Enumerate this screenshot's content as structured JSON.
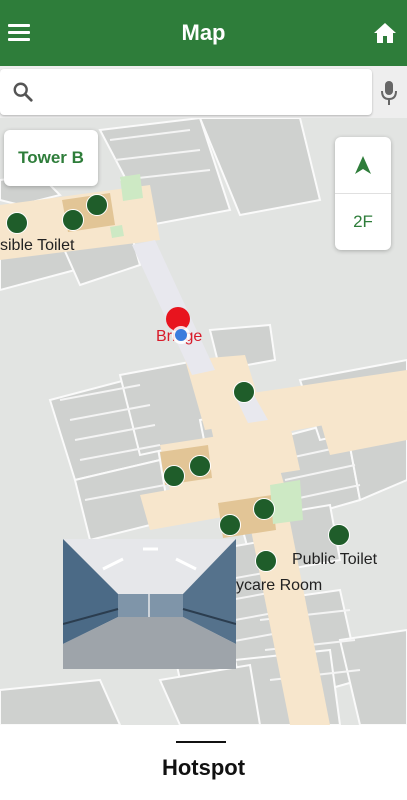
{
  "header": {
    "title": "Map",
    "menu_icon": "menu-icon",
    "home_icon": "home-icon"
  },
  "search": {
    "value": "",
    "placeholder": "",
    "search_icon": "search-icon",
    "mic_icon": "mic-icon"
  },
  "map": {
    "building": "Tower B",
    "floor": "2F",
    "compass_icon": "north-arrow-icon",
    "labels": {
      "accessible_toilet": "sible Toilet",
      "bridge": "Bridge",
      "public_toilet": "Public Toilet",
      "daycare_room": "ycare Room"
    },
    "colors": {
      "walkway": "#f7e6cc",
      "bridge": "#e8e8ee",
      "room": "#cfd1cf",
      "lift_area": "#e2c596",
      "green_area": "#cde9c4",
      "poi": "#1f5d2a",
      "pin": "#e8141e",
      "location": "#3b7ddd"
    }
  },
  "bottom_sheet": {
    "title": "Hotspot"
  }
}
